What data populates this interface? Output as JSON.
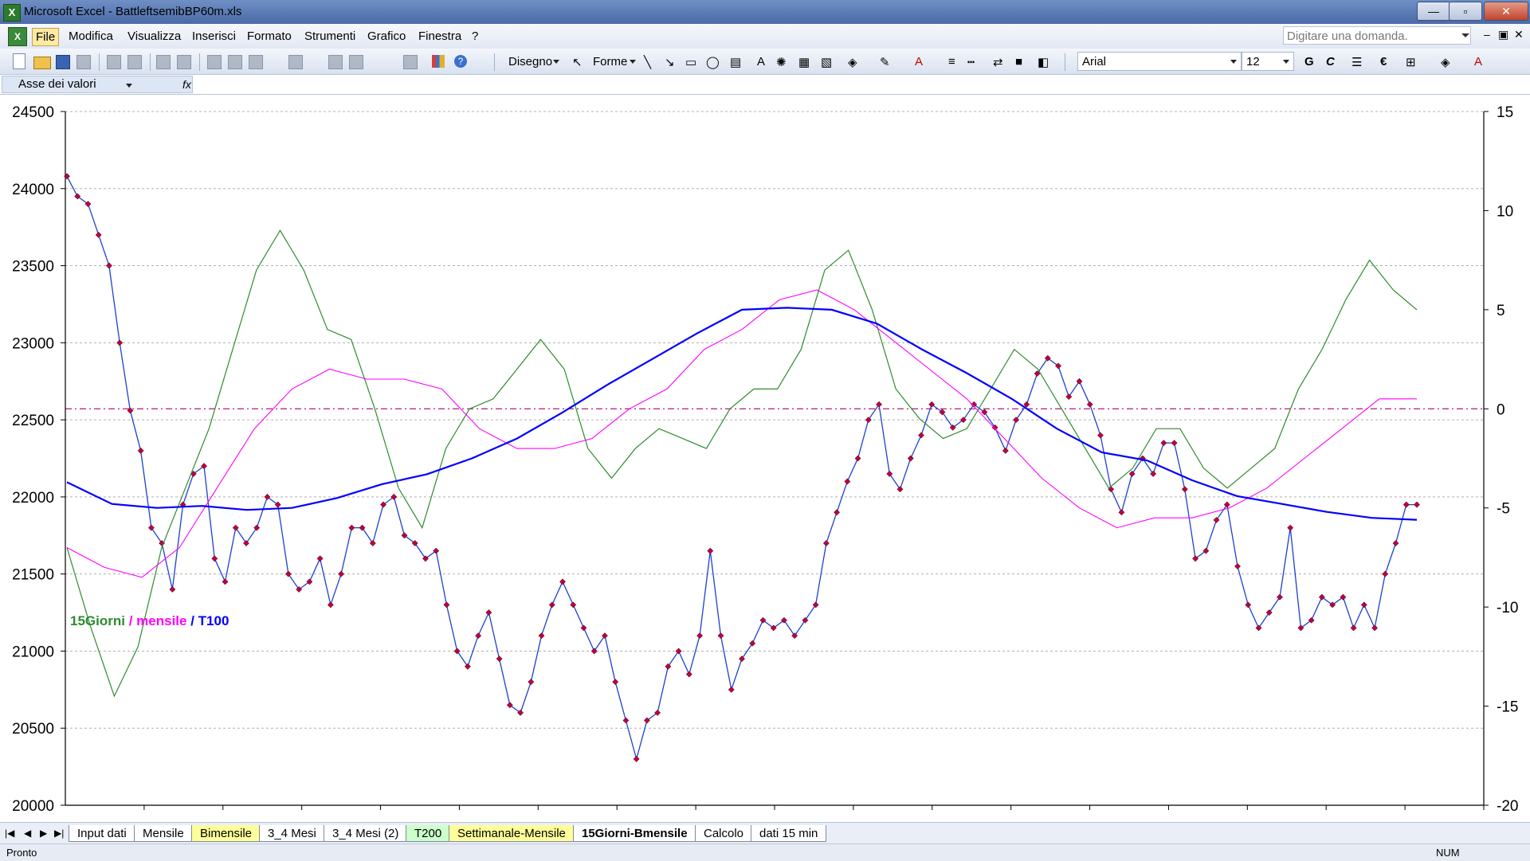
{
  "window": {
    "title": "Microsoft Excel - BattleftsemibBP60m.xls",
    "app_icon": "excel-icon"
  },
  "menu": {
    "items": [
      "File",
      "Modifica",
      "Visualizza",
      "Inserisci",
      "Formato",
      "Strumenti",
      "Grafico",
      "Finestra",
      "?"
    ],
    "ask_placeholder": "Digitare una domanda."
  },
  "toolbar": {
    "disegno": "Disegno",
    "forme": "Forme",
    "font_name": "Arial",
    "font_size": "12",
    "bold": "G",
    "italic": "C",
    "euro": "€"
  },
  "object_selector": {
    "value": "Asse dei valori"
  },
  "chart_data": {
    "type": "line",
    "title": "",
    "legend": [
      {
        "name": "15Giorni",
        "color": "#2e8b2e"
      },
      {
        "name": "mensile",
        "color": "#ff00ff"
      },
      {
        "name": "T100",
        "color": "#0000ff"
      }
    ],
    "legend_separators": [
      " / ",
      " / "
    ],
    "y_left": {
      "min": 20000,
      "max": 24500,
      "ticks": [
        20000,
        20500,
        21000,
        21500,
        22000,
        22500,
        23000,
        23500,
        24000,
        24500
      ]
    },
    "y_right": {
      "min": -20,
      "max": 15,
      "ticks": [
        -20,
        -15,
        -10,
        -5,
        0,
        5,
        10,
        15
      ]
    },
    "x_points": 480,
    "zero_line_right": 0,
    "series": [
      {
        "name": "price",
        "axis": "left",
        "color": "#1f3fd0",
        "marker_color": "#c00040",
        "values": [
          24080,
          23950,
          23900,
          23700,
          23500,
          23000,
          22560,
          22300,
          21800,
          21700,
          21400,
          21950,
          22150,
          22200,
          21600,
          21450,
          21800,
          21700,
          21800,
          22000,
          21950,
          21500,
          21400,
          21450,
          21600,
          21300,
          21500,
          21800,
          21800,
          21700,
          21950,
          22000,
          21750,
          21700,
          21600,
          21650,
          21300,
          21000,
          20900,
          21100,
          21250,
          20950,
          20650,
          20600,
          20800,
          21100,
          21300,
          21450,
          21300,
          21150,
          21000,
          21100,
          20800,
          20550,
          20300,
          20550,
          20600,
          20900,
          21000,
          20850,
          21100,
          21650,
          21100,
          20750,
          20950,
          21050,
          21200,
          21150,
          21200,
          21100,
          21200,
          21300,
          21700,
          21900,
          22100,
          22250,
          22500,
          22600,
          22150,
          22050,
          22250,
          22400,
          22600,
          22550,
          22450,
          22500,
          22600,
          22550,
          22450,
          22300,
          22500,
          22600,
          22800,
          22900,
          22850,
          22650,
          22750,
          22600,
          22400,
          22050,
          21900,
          22150,
          22250,
          22150,
          22350,
          22350,
          22050,
          21600,
          21650,
          21850,
          21950,
          21550,
          21300,
          21150,
          21250,
          21350,
          21800,
          21150,
          21200,
          21350,
          21300,
          21350,
          21150,
          21300,
          21150,
          21500,
          21700,
          21950,
          21950
        ],
        "line_width": 1.3
      },
      {
        "name": "15Giorni",
        "axis": "right",
        "color": "#2e8b2e",
        "values": [
          -7,
          -11,
          -14.5,
          -12,
          -7,
          -4,
          -1,
          3,
          7,
          9,
          7,
          4,
          3.5,
          0,
          -4,
          -6,
          -2,
          0,
          0.5,
          2,
          3.5,
          2,
          -2,
          -3.5,
          -2,
          -1,
          -1.5,
          -2,
          0,
          1,
          1,
          3,
          7,
          8,
          5,
          1,
          -0.5,
          -1.5,
          -1,
          1,
          3,
          2,
          0,
          -2,
          -4,
          -3,
          -1,
          -1,
          -3,
          -4,
          -3,
          -2,
          1,
          3,
          5.5,
          7.5,
          6,
          5
        ],
        "line_width": 1.2
      },
      {
        "name": "mensile",
        "axis": "right",
        "color": "#ff00ff",
        "values": [
          -7,
          -8,
          -8.5,
          -7,
          -4,
          -1,
          1,
          2,
          1.5,
          1.5,
          1,
          -1,
          -2,
          -2,
          -1.5,
          0,
          1,
          3,
          4,
          5.5,
          6,
          5,
          3.5,
          2,
          0.5,
          -1.5,
          -3.5,
          -5,
          -6,
          -5.5,
          -5.5,
          -5,
          -4,
          -2.5,
          -1,
          0.5,
          0.5
        ],
        "line_width": 1.1
      },
      {
        "name": "T100",
        "axis": "right",
        "color": "#0000ff",
        "values": [
          -3.7,
          -4.8,
          -5,
          -4.9,
          -5.1,
          -5,
          -4.5,
          -3.8,
          -3.3,
          -2.5,
          -1.5,
          -0.2,
          1.2,
          2.5,
          3.8,
          5,
          5.1,
          5,
          4.3,
          3,
          1.8,
          0.5,
          -1,
          -2.2,
          -2.6,
          -3.6,
          -4.4,
          -4.8,
          -5.2,
          -5.5,
          -5.6
        ],
        "line_width": 2.2
      }
    ]
  },
  "sheet_tabs": [
    {
      "label": "Input dati",
      "style": "white"
    },
    {
      "label": "Mensile",
      "style": "white"
    },
    {
      "label": "Bimensile",
      "style": "yellow"
    },
    {
      "label": "3_4 Mesi",
      "style": "white"
    },
    {
      "label": "3_4 Mesi (2)",
      "style": "white"
    },
    {
      "label": "T200",
      "style": "green"
    },
    {
      "label": "Settimanale-Mensile",
      "style": "yellow"
    },
    {
      "label": "15Giorni-Bmensile",
      "style": "active"
    },
    {
      "label": "Calcolo",
      "style": "white"
    },
    {
      "label": "dati 15 min",
      "style": "white"
    }
  ],
  "status": {
    "ready": "Pronto",
    "num": "NUM"
  }
}
